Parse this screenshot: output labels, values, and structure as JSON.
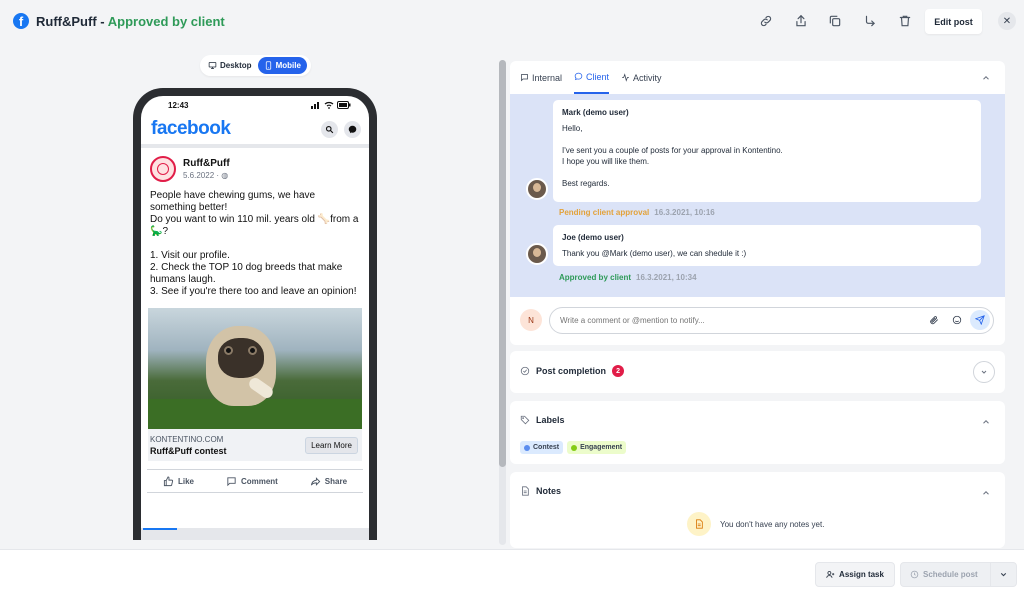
{
  "header": {
    "brand_icon": "facebook-icon",
    "post_name": "Ruff&Puff",
    "separator": " - ",
    "status": "Approved by client",
    "edit_label": "Edit post",
    "close_glyph": "✕",
    "status_color": "#2e9a58"
  },
  "device_toggle": {
    "desktop_label": "Desktop",
    "mobile_label": "Mobile",
    "selected": "Mobile"
  },
  "phone": {
    "time": "12:43",
    "fb_wordmark": "facebook",
    "page_name": "Ruff&Puff",
    "post_date": "5.6.2022 · ",
    "post_text": "People have chewing gums, we have something better!\nDo you want to win 110 mil. years old 🦴from a 🦕?\n\n1. Visit our profile.\n2. Check the TOP 10 dog breeds that make humans laugh.\n3. See if you're there too and leave an opinion!",
    "link_domain": "KONTENTINO.COM",
    "link_title": "Ruff&Puff contest",
    "learn_more": "Learn More",
    "actions": {
      "like": "Like",
      "comment": "Comment",
      "share": "Share"
    }
  },
  "comments": {
    "tabs": {
      "internal": "Internal",
      "client": "Client",
      "activity": "Activity"
    },
    "active_tab": "Client",
    "messages": [
      {
        "author": "Mark (demo user)",
        "text": "Hello,\n\nI've sent you a couple of posts for your approval in Kontentino.\nI hope you will like them.\n\nBest regards.",
        "status": "Pending client approval",
        "timestamp": "16.3.2021, 10:16",
        "status_color": "#e3a23a"
      },
      {
        "author": "Joe (demo user)",
        "text": "Thank you @Mark (demo user), we can shedule it :)",
        "status": "Approved by client",
        "timestamp": "16.3.2021, 10:34",
        "status_color": "#2e9a58"
      }
    ],
    "current_user_initial": "N",
    "input_placeholder": "Write a comment or @mention to notify..."
  },
  "post_completion": {
    "title": "Post completion",
    "count": "2"
  },
  "labels_section": {
    "title": "Labels",
    "items": [
      {
        "name": "Contest",
        "color": "#5b8def",
        "bg": "#dbeafe"
      },
      {
        "name": "Engagement",
        "color": "#84cc16",
        "bg": "#ecfccb"
      }
    ]
  },
  "notes_section": {
    "title": "Notes",
    "empty_text": "You don't have any notes yet."
  },
  "footer": {
    "assign_label": "Assign task",
    "schedule_label": "Schedule post"
  }
}
